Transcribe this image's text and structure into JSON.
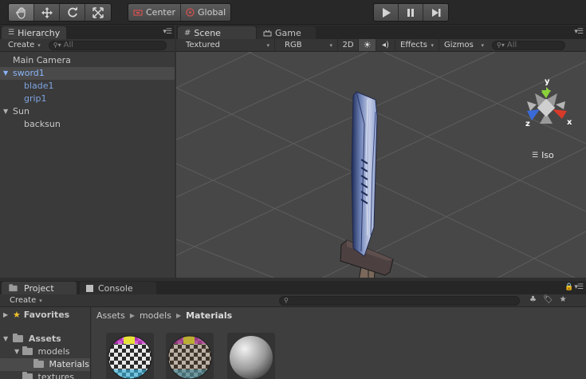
{
  "toolbar": {
    "tools": [
      "hand-tool",
      "move-tool",
      "rotate-tool",
      "scale-tool"
    ],
    "pivot_label": "Center",
    "space_label": "Global",
    "play_controls": [
      "play",
      "pause",
      "step"
    ]
  },
  "hierarchy": {
    "tab_label": "Hierarchy",
    "create_label": "Create",
    "search_placeholder": "All",
    "items": [
      {
        "label": "Main Camera"
      },
      {
        "label": "sword1"
      },
      {
        "label": "blade1"
      },
      {
        "label": "grip1"
      },
      {
        "label": "Sun"
      },
      {
        "label": "backsun"
      }
    ]
  },
  "scene": {
    "tab_label": "Scene",
    "game_tab_label": "Game",
    "shading_label": "Textured",
    "render_mode_label": "RGB",
    "mode_2d_label": "2D",
    "effects_label": "Effects",
    "gizmos_label": "Gizmos",
    "search_placeholder": "All",
    "gizmo_axes": {
      "y": "y",
      "x": "x",
      "z": "z"
    },
    "projection_label": "Iso",
    "colors": {
      "x_axis": "#d83a2a",
      "y_axis": "#8ad13a",
      "z_axis": "#3a6ad8"
    }
  },
  "project": {
    "tab_label": "Project",
    "console_tab_label": "Console",
    "create_label": "Create",
    "favorites_label": "Favorites",
    "assets_label": "Assets",
    "models_label": "models",
    "materials_label": "Materials",
    "textures_label": "textures",
    "breadcrumb": [
      "Assets",
      "models",
      "Materials"
    ]
  }
}
